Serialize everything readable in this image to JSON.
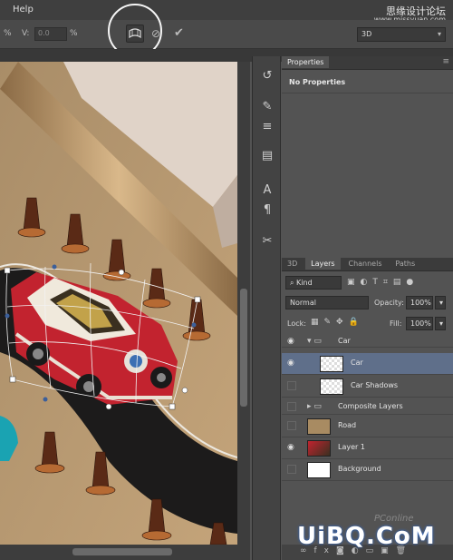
{
  "menu": {
    "help": "Help"
  },
  "watermark": {
    "line1": "思缘设计论坛",
    "line2": "www.missyuan.com",
    "bottom": "UiBQ.CoM",
    "pconline": "PConline"
  },
  "options": {
    "percent1": "%",
    "v_label": "V:",
    "v_value": "0.0",
    "percent2": "%",
    "mode": "3D"
  },
  "properties": {
    "tab": "Properties",
    "content": "No Properties"
  },
  "layers_panel": {
    "tabs": [
      "3D",
      "Layers",
      "Channels",
      "Paths"
    ],
    "kind": "Kind",
    "blend": "Normal",
    "opacity_label": "Opacity:",
    "opacity_value": "100%",
    "lock_label": "Lock:",
    "fill_label": "Fill:",
    "fill_value": "100%",
    "rows": [
      {
        "name": "Car",
        "type": "group",
        "visible": true
      },
      {
        "name": "Car",
        "type": "layer",
        "visible": true,
        "selected": true
      },
      {
        "name": "Car Shadows",
        "type": "layer",
        "visible": false
      },
      {
        "name": "Composite Layers",
        "type": "group",
        "visible": false
      },
      {
        "name": "Road",
        "type": "layer",
        "visible": false
      },
      {
        "name": "Layer 1",
        "type": "layer",
        "visible": true
      },
      {
        "name": "Background",
        "type": "layer",
        "visible": false
      }
    ]
  },
  "colors": {
    "accent_selection": "#5f6f8a",
    "panel_bg": "#535353"
  }
}
